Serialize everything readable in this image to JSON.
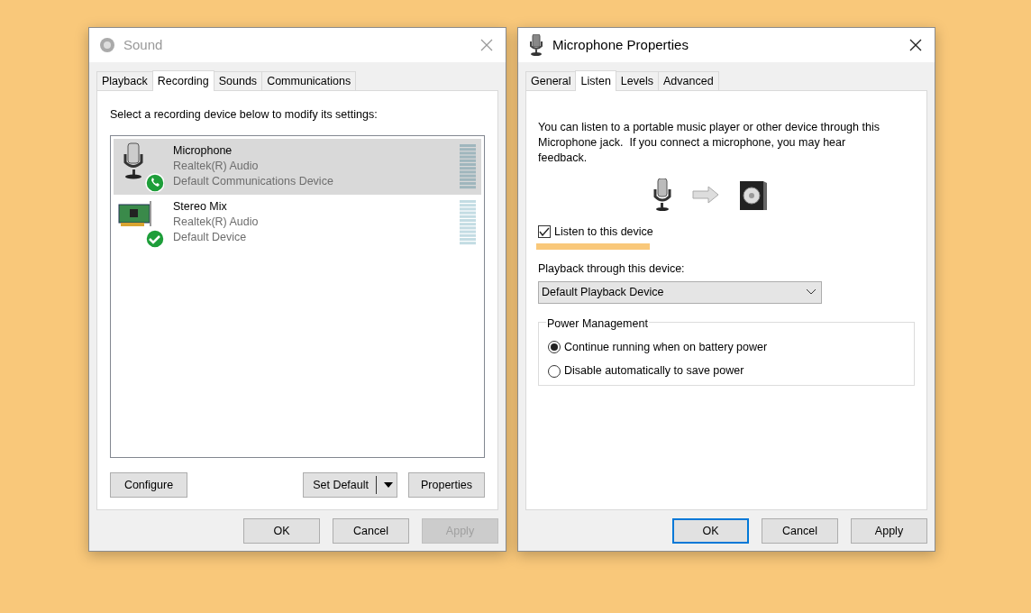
{
  "sound_window": {
    "title": "Sound",
    "tabs": [
      {
        "label": "Playback",
        "selected": false
      },
      {
        "label": "Recording",
        "selected": true
      },
      {
        "label": "Sounds",
        "selected": false
      },
      {
        "label": "Communications",
        "selected": false
      }
    ],
    "instruction": "Select a recording device below to modify its settings:",
    "devices": [
      {
        "kind": "microphone",
        "badge": {
          "kind": "phone"
        },
        "name": "Microphone",
        "driver": "Realtek(R) Audio",
        "status": "Default Communications Device",
        "selected": true
      },
      {
        "kind": "sound-card",
        "badge": {
          "kind": "check"
        },
        "name": "Stereo Mix",
        "driver": "Realtek(R) Audio",
        "status": "Default Device",
        "selected": false
      }
    ],
    "panel_buttons": [
      {
        "kind": "plain",
        "label": "Configure"
      },
      {
        "kind": "split",
        "label": "Set Default"
      },
      {
        "kind": "plain",
        "label": "Properties"
      }
    ],
    "buttons": [
      {
        "label": "OK",
        "disabled": false,
        "default": false
      },
      {
        "label": "Cancel",
        "disabled": false,
        "default": false
      },
      {
        "label": "Apply",
        "disabled": true,
        "default": false
      }
    ]
  },
  "properties_window": {
    "title": "Microphone Properties",
    "tabs": [
      {
        "label": "General",
        "selected": false
      },
      {
        "label": "Listen",
        "selected": true
      },
      {
        "label": "Levels",
        "selected": false
      },
      {
        "label": "Advanced",
        "selected": false
      }
    ],
    "description": "You can listen to a portable music player or other device through this Microphone jack.  If you connect a microphone, you may hear feedback.",
    "listen_checkbox": {
      "label": "Listen to this device",
      "checked": true,
      "highlighted": true
    },
    "playback_label": "Playback through this device:",
    "playback_select": {
      "value": "Default Playback Device"
    },
    "power_group": {
      "title": "Power Management",
      "options": [
        {
          "label": "Continue running when on battery power",
          "selected": true
        },
        {
          "label": "Disable automatically to save power",
          "selected": false
        }
      ]
    },
    "buttons": [
      {
        "label": "OK",
        "disabled": false,
        "default": true
      },
      {
        "label": "Cancel",
        "disabled": false,
        "default": false
      },
      {
        "label": "Apply",
        "disabled": false,
        "default": false
      }
    ]
  }
}
